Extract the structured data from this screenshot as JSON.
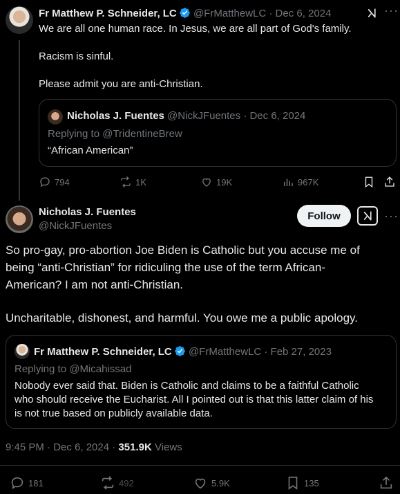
{
  "reply_tweet": {
    "author_name": "Fr Matthew P. Schneider, LC",
    "author_handle": "@FrMatthewLC",
    "date": "· Dec 6, 2024",
    "lines": [
      "We are all one human race. In Jesus, we are all part of God's family.",
      "Racism is sinful.",
      "Please admit you are anti-Christian."
    ],
    "quote": {
      "author_name": "Nicholas J. Fuentes",
      "author_handle": "@NickJFuentes",
      "date": "· Dec 6, 2024",
      "replying_to": "Replying to @TridentineBrew",
      "text": "“African American”"
    },
    "stats": {
      "replies": "794",
      "reposts": "1K",
      "likes": "19K",
      "views": "967K"
    }
  },
  "main_tweet": {
    "author_name": "Nicholas J. Fuentes",
    "author_handle": "@NickJFuentes",
    "follow_label": "Follow",
    "lines": [
      "So pro-gay, pro-abortion Joe Biden is Catholic but you accuse me of",
      "being “anti-Christian” for ridiculing the use of the term African-",
      "American? I am not anti-Christian.",
      "Uncharitable, dishonest, and harmful. You owe me a public apology."
    ],
    "quote": {
      "author_name": "Fr Matthew P. Schneider, LC",
      "author_handle": "@FrMatthewLC",
      "date": "· Feb 27, 2023",
      "replying_to": "Replying to @Micahissad",
      "lines": [
        "Nobody ever said that. Biden is Catholic and claims to be a faithful Catholic",
        "who should receive the Eucharist. All I pointed out is that this latter claim of his",
        "is not true based on publicly available data."
      ]
    },
    "meta": {
      "time_date": "9:45 PM · Dec 6, 2024 · ",
      "views_count": "351.9K",
      "views_label": " Views"
    },
    "stats": {
      "replies": "181",
      "reposts": "492",
      "likes": "5.9K",
      "bookmarks": "135"
    }
  },
  "colors": {
    "background": "#000000",
    "text": "#e7e9ea",
    "muted": "#71767b",
    "border": "#2f3336",
    "verified": "#1d9bf0"
  },
  "icons": [
    "verified-badge-icon",
    "grok-icon",
    "more-icon",
    "reply-icon",
    "repost-icon",
    "like-icon",
    "views-icon",
    "bookmark-icon",
    "share-icon"
  ]
}
